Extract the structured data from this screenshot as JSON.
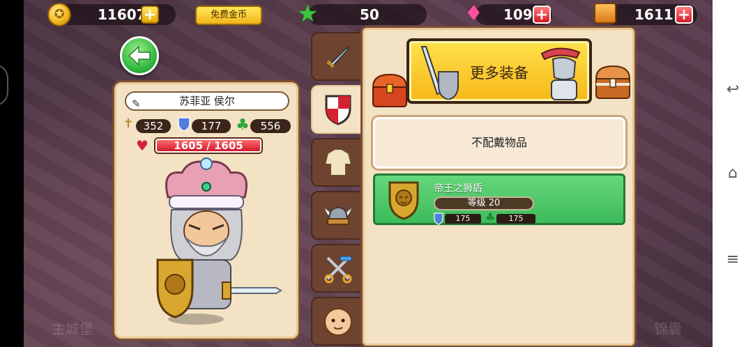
{
  "top_bar": {
    "coins": "11607",
    "free_coins_label": "免费金币",
    "stars": "50",
    "gems": "109",
    "boxes": "1611"
  },
  "character": {
    "name": "苏菲亚 侯尔",
    "attack": "352",
    "defense": "177",
    "luck": "556",
    "hp": "1605 / 1605"
  },
  "tabs": [
    {
      "icon": "sword-icon"
    },
    {
      "icon": "shield-icon",
      "active": true
    },
    {
      "icon": "armor-icon"
    },
    {
      "icon": "viking-helmet-icon"
    },
    {
      "icon": "scissors-comb-icon"
    },
    {
      "icon": "face-icon"
    }
  ],
  "equip_panel": {
    "more_equipment_label": "更多装备",
    "unequip_label": "不配戴物品",
    "item": {
      "name": "帝王之狮盾",
      "level": "等级 20",
      "defense": "175",
      "luck": "175"
    }
  },
  "colors": {
    "panel": "#f3e2c4",
    "panel_border": "#7a4e33",
    "green_card": "#4ac866",
    "gold_button": "#f6b816",
    "hp_red": "#d01b2b"
  }
}
